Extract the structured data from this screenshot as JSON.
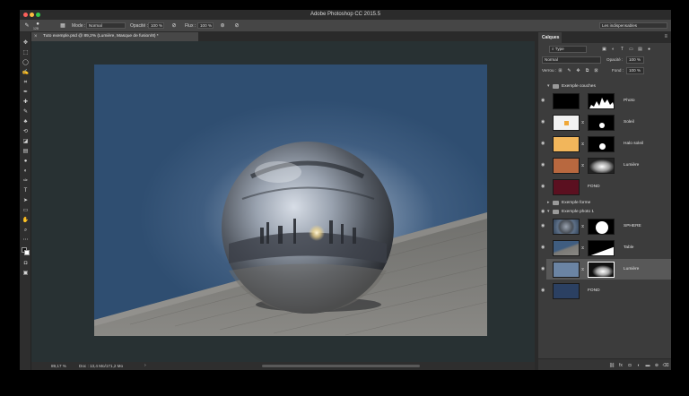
{
  "app": {
    "title": "Adobe Photoshop CC 2015.5"
  },
  "options_bar": {
    "brush_size": "128",
    "mode_label": "Mode :",
    "mode_value": "Normal",
    "opacity_label": "Opacité :",
    "opacity_value": "100 %",
    "flow_label": "Flux :",
    "flow_value": "100 %",
    "workspace": "Les indispensables"
  },
  "document": {
    "tab_title": "Tuto exemple.psd @ 89,2% (Lumière, Masque de fusion/8) *",
    "zoom": "89,17 %",
    "doc_size": "Doc : 13,4 Mo/171,2 Mo"
  },
  "layers_panel": {
    "tab": "Calques",
    "filter_value": "Type",
    "blend_mode": "Normal",
    "opacity_label": "Opacité :",
    "opacity_value": "100 %",
    "lock_label": "Verrou :",
    "fill_label": "Fond :",
    "fill_value": "100 %",
    "groups": {
      "couches": "Exemple couches",
      "forme": "Exemple forme",
      "photo": "Exemple photo 1"
    },
    "layers": {
      "photo": "Photo",
      "soleil": "Soleil",
      "halo": "Halo soleil",
      "lumiere1": "Lumière",
      "fond1": "FOND",
      "sphere": "SPHERE",
      "table": "Table",
      "lumiere2": "Lumière",
      "fond2": "FOND"
    },
    "colors": {
      "halo_fill": "#f2b65b",
      "lumiere_fill": "#b8683f",
      "fond_fill": "#5b1020",
      "photo_fond_fill": "#2b4062"
    }
  },
  "icons": [
    "brush-icon",
    "move-icon",
    "marquee-icon",
    "lasso-icon",
    "crop-icon",
    "eyedropper-icon",
    "eye-icon",
    "folder-icon",
    "link-icon",
    "trash-icon",
    "new-layer-icon",
    "mask-icon",
    "fx-icon",
    "adjustment-icon",
    "lock-icon"
  ]
}
